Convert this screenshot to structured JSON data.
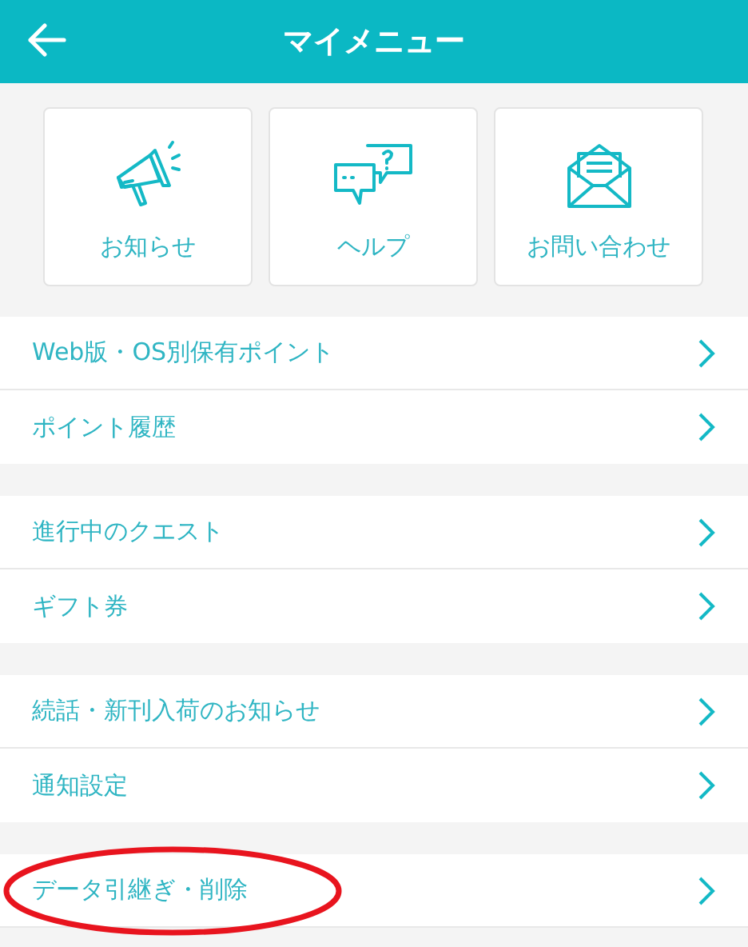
{
  "header": {
    "title": "マイメニュー"
  },
  "shortcuts": [
    {
      "kind": "megaphone",
      "label": "お知らせ"
    },
    {
      "kind": "chat",
      "label": "ヘルプ"
    },
    {
      "kind": "mail",
      "label": "お問い合わせ"
    }
  ],
  "menu_groups": [
    [
      {
        "label": "Web版・OS別保有ポイント",
        "circled": false
      },
      {
        "label": "ポイント履歴",
        "circled": false
      }
    ],
    [
      {
        "label": "進行中のクエスト",
        "circled": false
      },
      {
        "label": "ギフト券",
        "circled": false
      }
    ],
    [
      {
        "label": "続話・新刊入荷のお知らせ",
        "circled": false
      },
      {
        "label": "通知設定",
        "circled": false
      }
    ],
    [
      {
        "label": "データ引継ぎ・削除",
        "circled": true
      }
    ]
  ]
}
